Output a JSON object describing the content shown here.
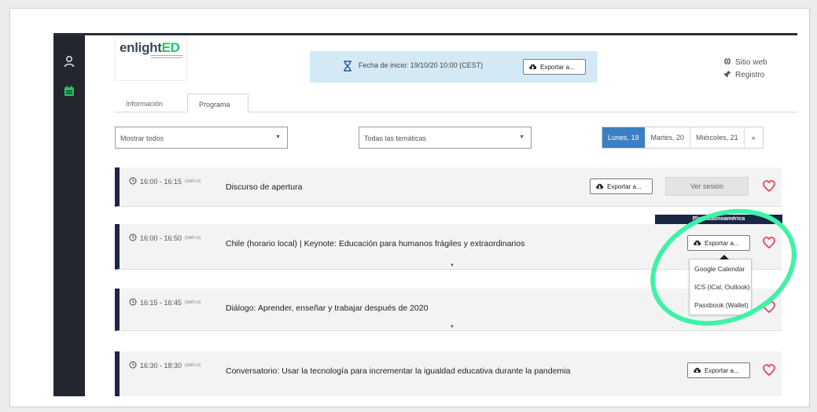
{
  "logo": {
    "brand_a": "enlight",
    "brand_b": "ED"
  },
  "banner": {
    "label": "Fecha de inicio:",
    "value": "19/10/20 10:00 (CEST)",
    "export_label": "Exportar a..."
  },
  "links": [
    {
      "label": "Sitio web",
      "icon": "globe-icon"
    },
    {
      "label": "Registro",
      "icon": "pin-icon"
    }
  ],
  "tabs": [
    {
      "label": "Información"
    },
    {
      "label": "Programa"
    }
  ],
  "filters": {
    "show": "Mostrar todos",
    "topics": "Todas las temáticas"
  },
  "days": {
    "items": [
      "Lunes, 19",
      "Martes, 20",
      "Miércoles, 21"
    ],
    "next": "»"
  },
  "plato_label": "Plató Latinoamérica",
  "sessions": [
    {
      "time": "16:00 - 16:15",
      "tz": "(GMT+2)",
      "title": "Discurso de apertura",
      "export_label": "Exportar a...",
      "view_label": "Ver sesión"
    },
    {
      "time": "16:00 - 16:50",
      "tz": "(GMT+2)",
      "title": "Chile (horario local) | Keynote: Educación para humanos frágiles y extraordinarios",
      "export_label": "Exportar a..."
    },
    {
      "time": "16:15 - 16:45",
      "tz": "(GMT+2)",
      "title": "Diálogo: Aprender, enseñar y trabajar después de 2020"
    },
    {
      "time": "16:30 - 18:30",
      "tz": "(GMT+2)",
      "title": "Conversatorio: Usar la tecnología para incrementar la igualdad educativa durante la pandemia",
      "export_label": "Exportar a..."
    }
  ],
  "dropdown": [
    "Google Calendar",
    "ICS (iCal, Outlook)",
    "Passbook (Wallet)"
  ],
  "colors": {
    "sidebar": "#22262d",
    "accent": "#3b7fc4",
    "card_border": "#1b2645",
    "highlight": "#3ff2a6",
    "heart": "#e24b5b"
  }
}
